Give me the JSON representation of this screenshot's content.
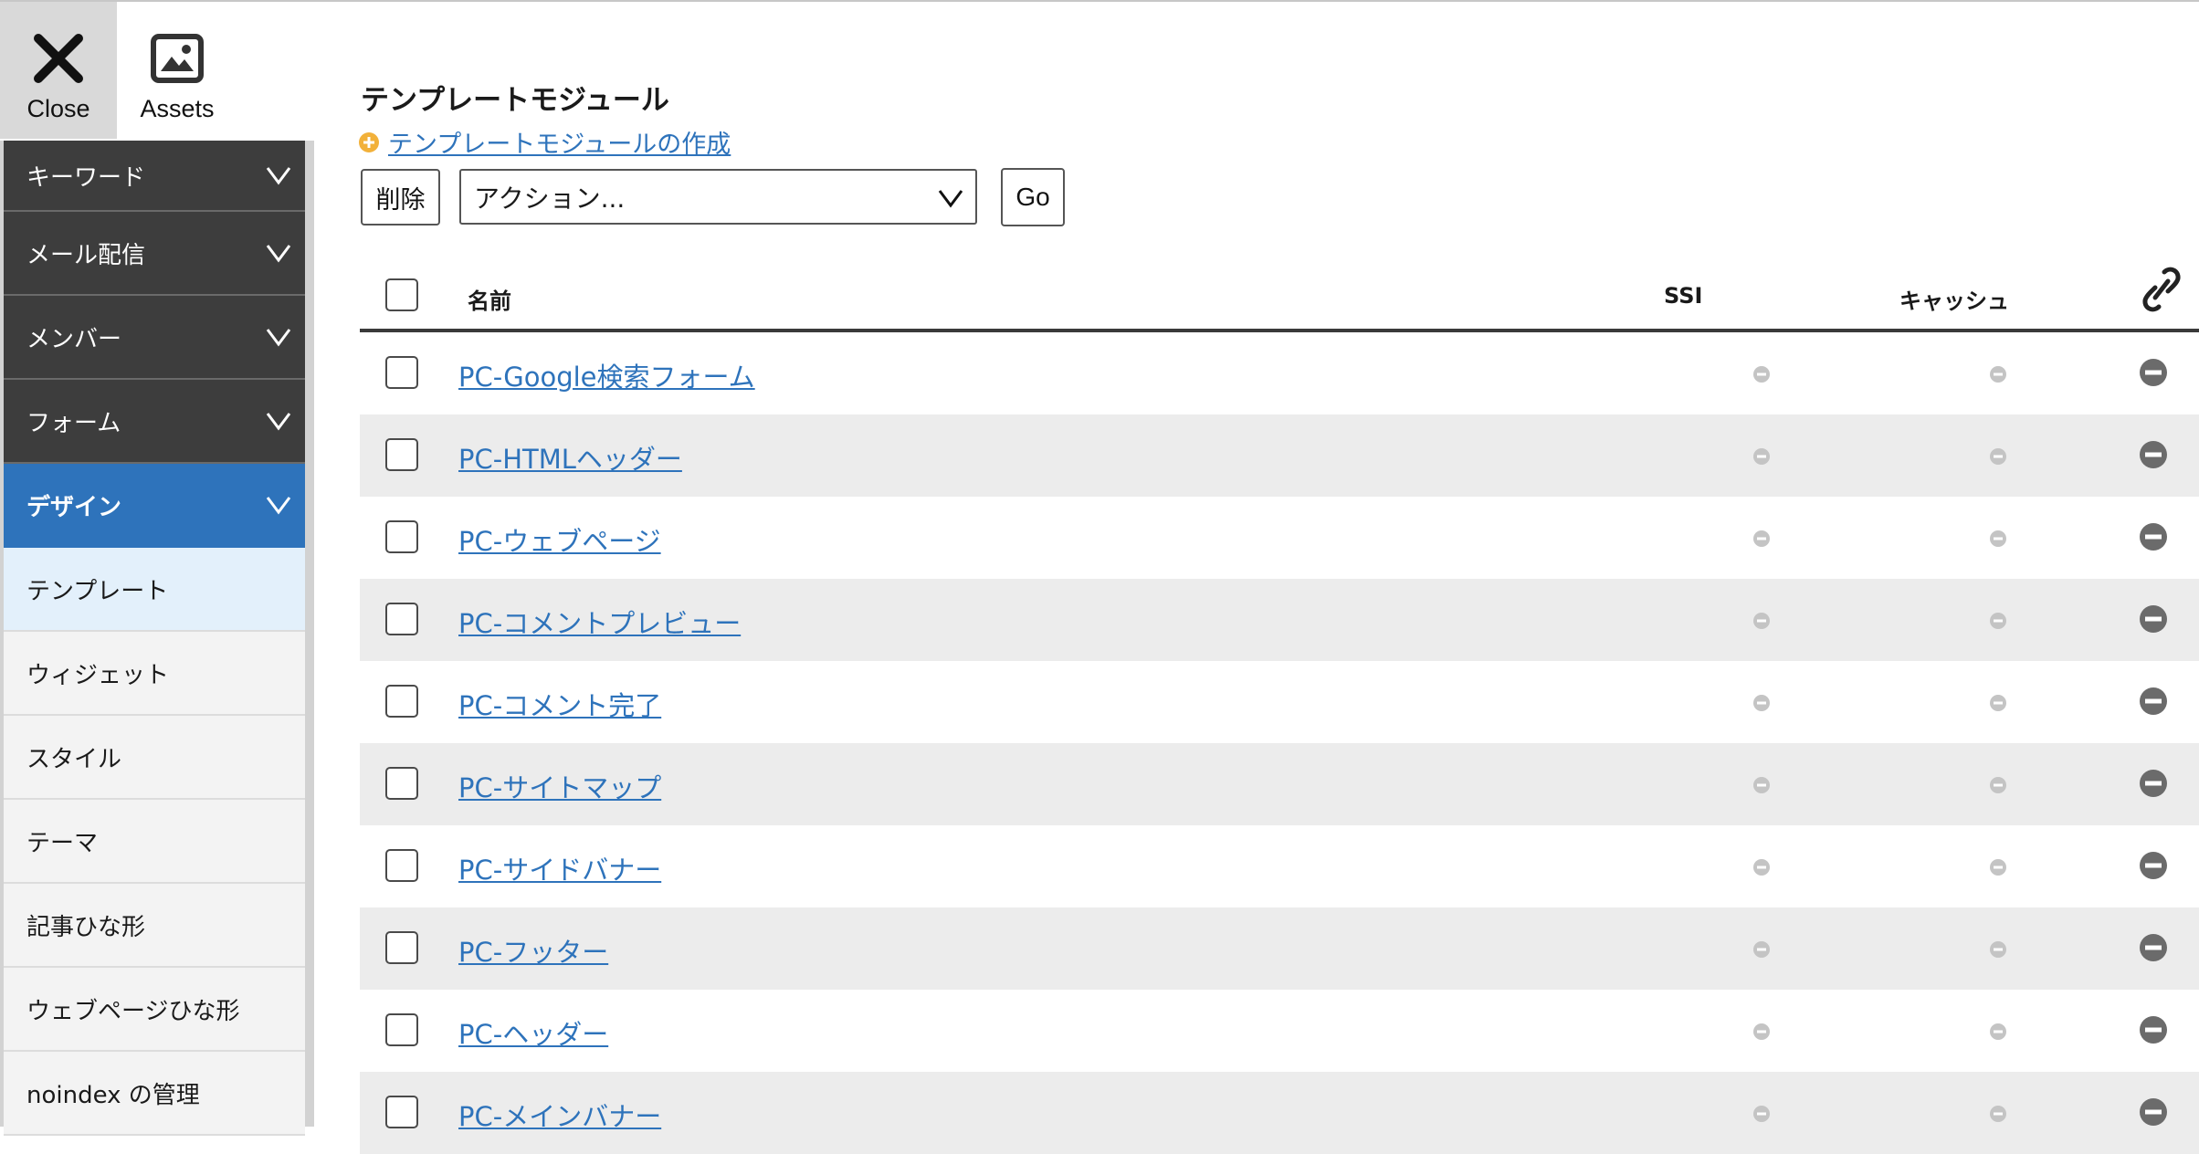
{
  "toolbar": {
    "close_label": "Close",
    "assets_label": "Assets"
  },
  "sidebar": {
    "items": [
      {
        "label": "キーワード"
      },
      {
        "label": "メール配信"
      },
      {
        "label": "メンバー"
      },
      {
        "label": "フォーム"
      },
      {
        "label": "デザイン"
      }
    ],
    "sub_items": [
      {
        "label": "テンプレート"
      },
      {
        "label": "ウィジェット"
      },
      {
        "label": "スタイル"
      },
      {
        "label": "テーマ"
      },
      {
        "label": "記事ひな形"
      },
      {
        "label": "ウェブページひな形"
      },
      {
        "label": "noindex の管理"
      }
    ]
  },
  "main": {
    "title": "テンプレートモジュール",
    "create_link": "テンプレートモジュールの作成",
    "delete_button": "削除",
    "action_select": "アクション...",
    "go_button": "Go"
  },
  "table": {
    "columns": {
      "name": "名前",
      "ssi": "SSI",
      "cache": "キャッシュ"
    },
    "rows": [
      {
        "name": "PC-Google検索フォーム"
      },
      {
        "name": "PC-HTMLヘッダー"
      },
      {
        "name": "PC-ウェブページ"
      },
      {
        "name": "PC-コメントプレビュー"
      },
      {
        "name": "PC-コメント完了"
      },
      {
        "name": "PC-サイトマップ"
      },
      {
        "name": "PC-サイドバナー"
      },
      {
        "name": "PC-フッター"
      },
      {
        "name": "PC-ヘッダー"
      },
      {
        "name": "PC-メインバナー"
      }
    ]
  },
  "colors": {
    "accent": "#2e73bb",
    "sidebar_dark": "#3d3d3d",
    "row_stripe": "#ececec"
  },
  "icons": {
    "close": "close-icon",
    "assets": "image-icon",
    "chevron": "chevron-down-icon",
    "plus": "plus-circle-icon",
    "link": "link-icon",
    "disabled": "minus-circle-icon"
  }
}
